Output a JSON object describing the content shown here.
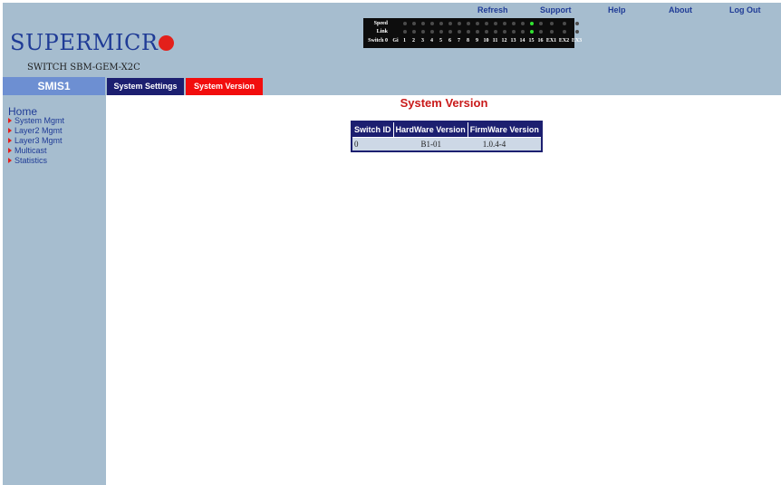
{
  "header": {
    "brand": "SUPERMICR",
    "model": "SWITCH SBM-GEM-X2C",
    "links": [
      "Refresh",
      "Support",
      "Help",
      "About",
      "Log Out"
    ]
  },
  "port_panel": {
    "speed_label": "Speed",
    "link_label": "Link",
    "switch_label": "Switch 0",
    "ports": [
      "Gi",
      "1",
      "2",
      "3",
      "4",
      "5",
      "6",
      "7",
      "8",
      "9",
      "10",
      "11",
      "12",
      "13",
      "14",
      "15",
      "16",
      "EX1",
      "EX2",
      "EX3"
    ],
    "active_port": "15",
    "colors": {
      "active": "#31e331",
      "inactive": "#4b4b4b"
    }
  },
  "nav": {
    "title": "SMIS1",
    "tabs": [
      "System Settings",
      "System Version"
    ],
    "active_tab": "System Version"
  },
  "sidebar": {
    "home": "Home",
    "items": [
      "System Mgmt",
      "Layer2 Mgmt",
      "Layer3 Mgmt",
      "Multicast",
      "Statistics"
    ]
  },
  "main": {
    "title": "System Version",
    "table": {
      "headers": [
        "Switch ID",
        "HardWare Version",
        "FirmWare Version"
      ],
      "rows": [
        [
          "0",
          "B1-01",
          "1.0.4-4"
        ]
      ]
    }
  },
  "colors": {
    "header_bg": "#a6bdcf",
    "brand_blue": "#1f3b96",
    "tab_dark": "#1c1f70",
    "tab_active": "#f20d0d",
    "title_red": "#c91a1a"
  }
}
